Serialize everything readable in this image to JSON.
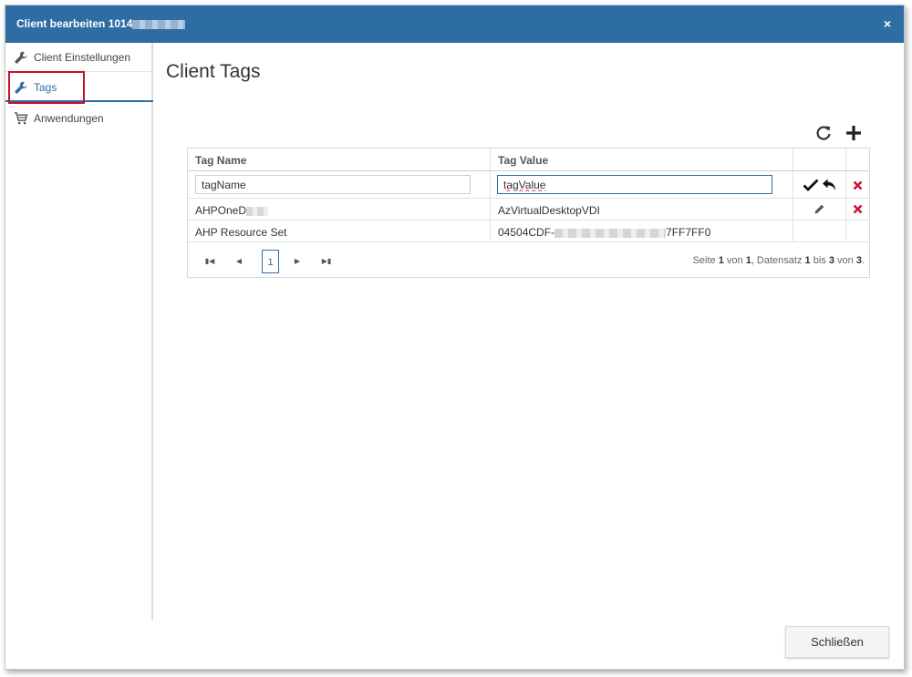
{
  "dialog": {
    "title": "Client bearbeiten 1014",
    "close_label": "×"
  },
  "sidebar": {
    "items": [
      {
        "label": "Client Einstellungen",
        "icon": "wrench-icon"
      },
      {
        "label": "Tags",
        "icon": "wrench-icon",
        "active": true
      },
      {
        "label": "Anwendungen",
        "icon": "cart-icon"
      }
    ]
  },
  "main": {
    "title": "Client Tags"
  },
  "grid": {
    "columns": [
      "Tag Name",
      "Tag Value"
    ],
    "edit_row": {
      "name_value": "tagName",
      "value_value": "tagValue"
    },
    "rows": [
      {
        "name": "AHPOneD",
        "value": "AzVirtualDesktopVDI"
      },
      {
        "name": "AHP Resource Set",
        "value_prefix": "04504CDF-",
        "value_suffix": "7FF7FF0"
      }
    ],
    "pager": {
      "current_page": "1",
      "info": {
        "t1": "Seite ",
        "page": "1",
        "t2": " von ",
        "pages": "1",
        "t3": ", Datensatz ",
        "from": "1",
        "t4": " bis ",
        "to": "3",
        "t5": " von ",
        "total": "3",
        "t6": "."
      }
    }
  },
  "footer": {
    "close_button": "Schließen"
  },
  "colors": {
    "accent": "#2e6da4",
    "highlight": "#c8102e",
    "delete": "#c8102e"
  }
}
